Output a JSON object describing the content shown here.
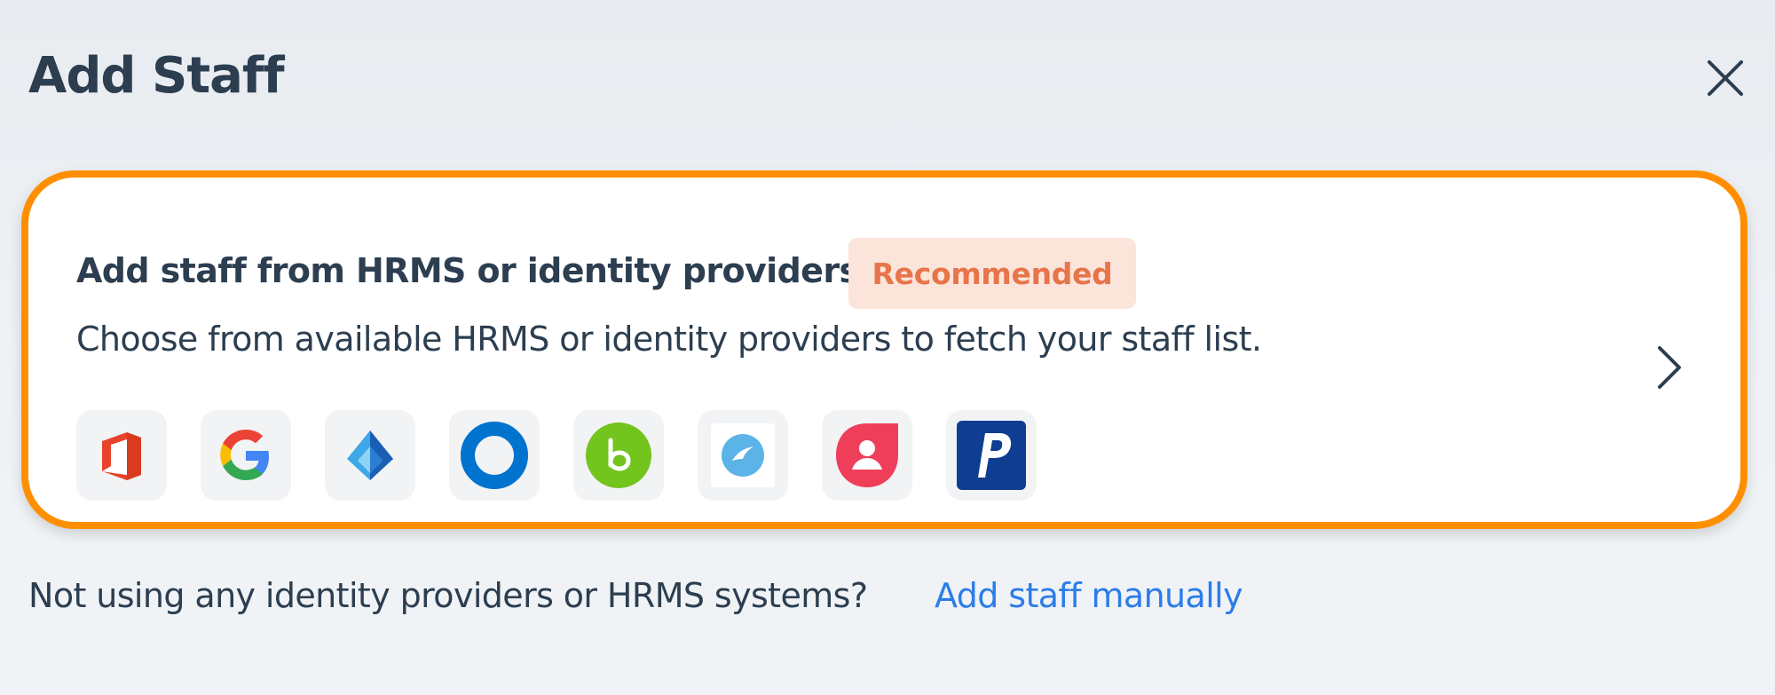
{
  "dialog": {
    "title": "Add Staff",
    "close_icon": "close-icon"
  },
  "card": {
    "heading": "Add staff from HRMS or identity providers",
    "badge": "Recommended",
    "description": "Choose from available HRMS or identity providers to fetch your staff list.",
    "chevron_icon": "chevron-right-icon",
    "border_color": "#ff8f00",
    "providers": [
      {
        "icon": "microsoft-office-icon"
      },
      {
        "icon": "google-icon"
      },
      {
        "icon": "azure-ad-icon"
      },
      {
        "icon": "okta-icon"
      },
      {
        "icon": "bamboohr-icon"
      },
      {
        "icon": "provider-blue-circle-icon"
      },
      {
        "icon": "provider-red-person-icon"
      },
      {
        "icon": "paylocity-icon"
      }
    ]
  },
  "footer": {
    "text": "Not using any identity providers or HRMS systems?",
    "link": "Add staff manually",
    "link_color": "#2b7de9"
  }
}
